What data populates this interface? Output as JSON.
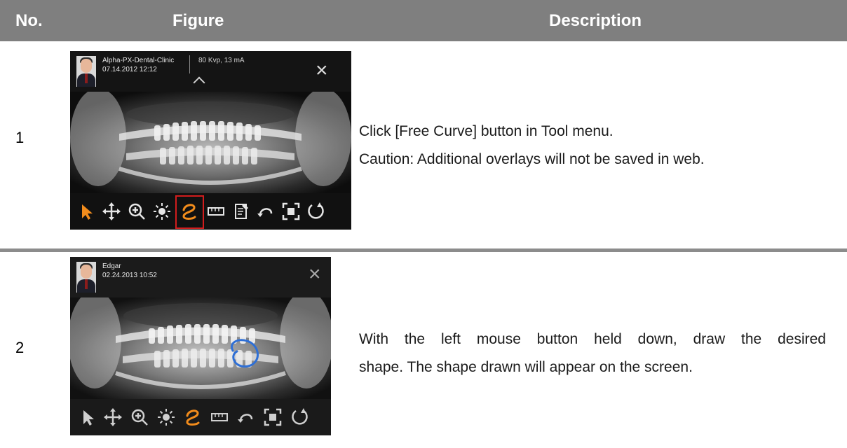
{
  "header": {
    "no": "No.",
    "figure": "Figure",
    "description": "Description"
  },
  "rows": [
    {
      "no": "1",
      "figure": {
        "patient_name": "Alpha-PX-Dental-Clinic",
        "datetime": "07.14.2012 12:12",
        "exposure": "80 Kvp, 13 mA",
        "selected_tool": "free-curve"
      },
      "lines": [
        "Click [Free Curve] button in Tool menu.",
        "Caution: Additional overlays will not be saved in web."
      ]
    },
    {
      "no": "2",
      "figure": {
        "patient_name": "Edgar",
        "datetime": "02.24.2013 10:52",
        "selected_tool": "free-curve"
      },
      "lines": [
        "With the left mouse button held down, draw the desired",
        "shape. The shape drawn will appear on the screen."
      ]
    }
  ],
  "colors": {
    "header": "#7f7f7f",
    "highlight": "#d21d1d",
    "active_tool": "#f28c1c",
    "curve": "#2e6fd6"
  },
  "icons": [
    "pointer-icon",
    "pan-icon",
    "zoom-icon",
    "brightness-icon",
    "free-curve-icon",
    "ruler-icon",
    "note-icon",
    "undo-icon",
    "fit-screen-icon",
    "rotate-icon"
  ]
}
